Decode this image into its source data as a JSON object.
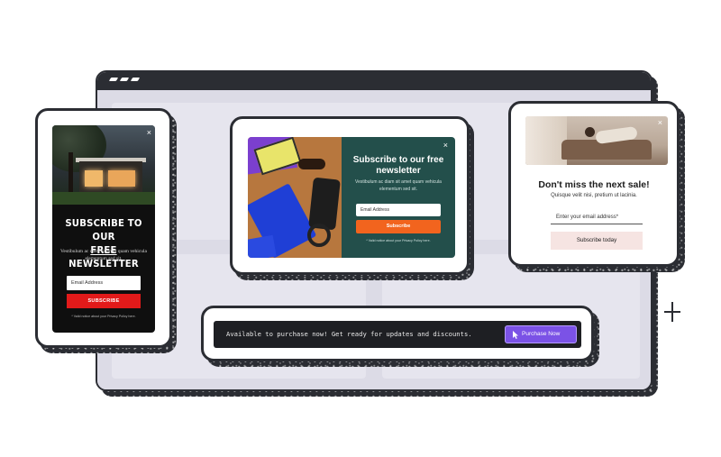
{
  "mobile_popup": {
    "title_line1": "SUBSCRIBE TO OUR",
    "title_free": "FREE",
    "title_rest": " NEWSLETTER",
    "body": "Vestibulum ac diam sit amet quam vehicula elementum sed sit.",
    "email_placeholder": "Email Address",
    "button_label": "SUBSCRIBE",
    "fine_print": "* Valid notice about your Privacy Policy here.",
    "close_glyph": "×"
  },
  "newsletter_popup": {
    "title": "Subscribe to our free newsletter",
    "body": "Vestibulum ac diam sit amet quam vehicula elementum sed sit.",
    "email_placeholder": "Email Address",
    "button_label": "Subscribe",
    "fine_print": "* Valid notice about your Privacy Policy here.",
    "close_glyph": "×",
    "accent_color": "#f2641e",
    "panel_color": "#234f4b"
  },
  "sale_popup": {
    "title": "Don't miss the next sale!",
    "subtitle": "Quisque velit nisi, pretium ut lacinia.",
    "email_placeholder": "Enter your email address*",
    "button_label": "Subscribe today",
    "close_glyph": "×"
  },
  "purchase_bar": {
    "message": "Available to purchase now! Get ready for updates and discounts.",
    "button_label": "Purchase Now",
    "button_color": "#7b52e6"
  },
  "icons": [
    "window-dots-icon",
    "close-icon",
    "cursor-icon",
    "plus-icon"
  ]
}
